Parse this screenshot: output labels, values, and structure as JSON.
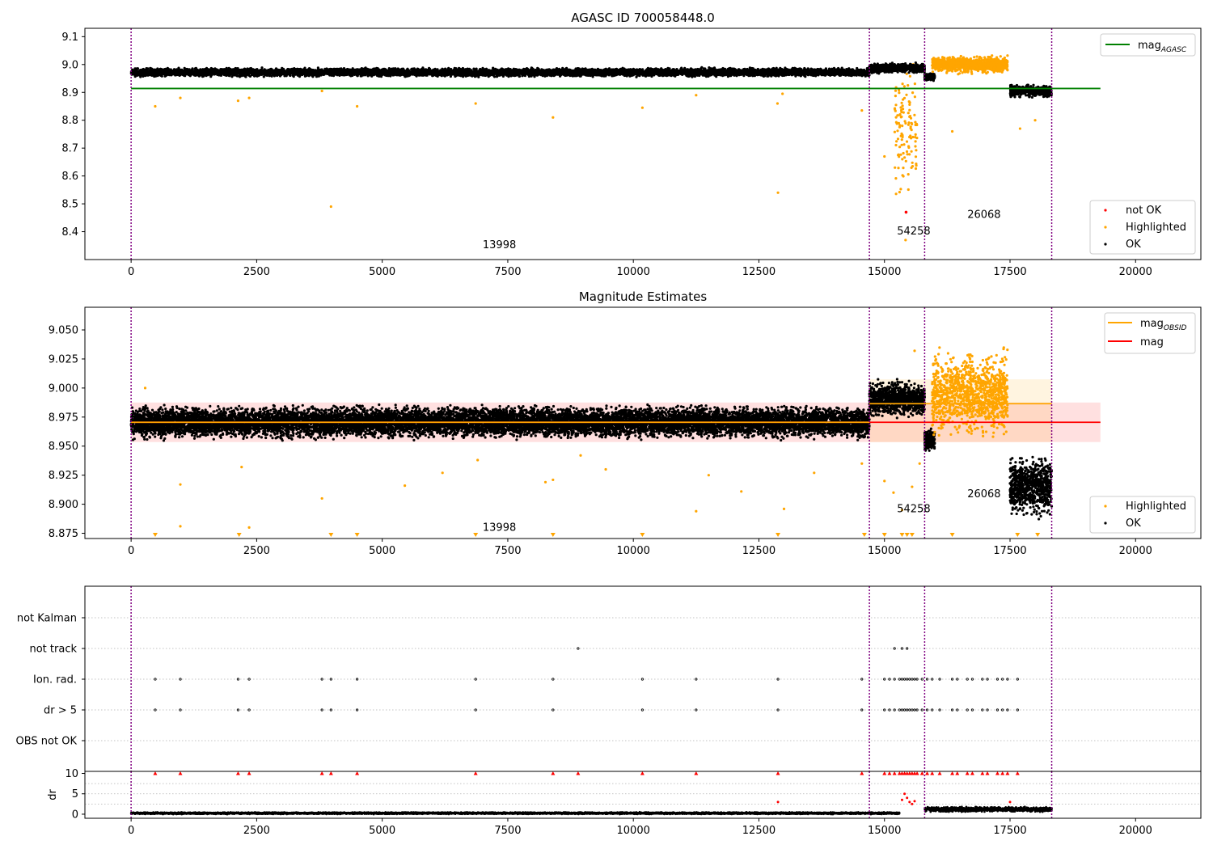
{
  "figure": {
    "vlines_x": [
      0,
      14700,
      15800,
      18330
    ],
    "colors": {
      "ok": "#000000",
      "highlighted": "#ffa500",
      "not_ok": "#ff0000",
      "mag_agasc": "#008000",
      "mag_obsid": "#ffa500",
      "mag": "#ff0000",
      "vline": "#800080",
      "grid": "#b0b0b0"
    }
  },
  "chart_data": [
    {
      "type": "scatter",
      "title": "AGASC ID 700058448.0",
      "xlim": [
        -920,
        21300
      ],
      "ylim": [
        8.3,
        9.13
      ],
      "xticks": [
        0,
        2500,
        5000,
        7500,
        10000,
        12500,
        15000,
        17500,
        20000
      ],
      "yticks": [
        8.4,
        8.5,
        8.6,
        8.7,
        8.8,
        8.9,
        9.0,
        9.1
      ],
      "ytick_labels": [
        "8.4",
        "8.5",
        "8.6",
        "8.7",
        "8.8",
        "8.9",
        "9.0",
        "9.1"
      ],
      "hlines": [
        {
          "name": "mag",
          "sub": "AGASC",
          "y": 8.914,
          "x_range": [
            0,
            19300
          ],
          "color": "#008000"
        }
      ],
      "ok_segments": [
        {
          "x": [
            0,
            14700
          ],
          "center": 8.972,
          "spread": 0.012
        },
        {
          "x": [
            14700,
            15800
          ],
          "center": 8.987,
          "spread": 0.014
        },
        {
          "x": [
            15800,
            16000
          ],
          "center": 8.955,
          "spread": 0.01
        },
        {
          "x": [
            17500,
            18330
          ],
          "center": 8.905,
          "spread": 0.018
        }
      ],
      "highlighted_segments": [
        {
          "x": [
            15950,
            17450
          ],
          "center": 9.0,
          "spread": 0.025
        },
        {
          "x": [
            15200,
            15650
          ],
          "center": 8.75,
          "spread": 0.2
        }
      ],
      "highlighted_points": [
        {
          "x": 480,
          "y": 8.85
        },
        {
          "x": 980,
          "y": 8.88
        },
        {
          "x": 2130,
          "y": 8.87
        },
        {
          "x": 2350,
          "y": 8.88
        },
        {
          "x": 3800,
          "y": 8.905
        },
        {
          "x": 3980,
          "y": 8.49
        },
        {
          "x": 4500,
          "y": 8.85
        },
        {
          "x": 6860,
          "y": 8.86
        },
        {
          "x": 8400,
          "y": 8.81
        },
        {
          "x": 10180,
          "y": 8.845
        },
        {
          "x": 11250,
          "y": 8.89
        },
        {
          "x": 12880,
          "y": 8.54
        },
        {
          "x": 12870,
          "y": 8.86
        },
        {
          "x": 12970,
          "y": 8.895
        },
        {
          "x": 14550,
          "y": 8.835
        },
        {
          "x": 15000,
          "y": 8.67
        },
        {
          "x": 15420,
          "y": 8.37
        },
        {
          "x": 16350,
          "y": 8.76
        },
        {
          "x": 17700,
          "y": 8.77
        },
        {
          "x": 18000,
          "y": 8.8
        }
      ],
      "not_ok_points": [
        {
          "x": 15430,
          "y": 8.47
        }
      ],
      "annotations": [
        {
          "text": "13998",
          "x": 7000,
          "y": 8.34
        },
        {
          "text": "54258",
          "x": 15250,
          "y": 8.39
        },
        {
          "text": "26068",
          "x": 16650,
          "y": 8.45
        }
      ],
      "legend_main": {
        "position": "top-right",
        "entries": [
          {
            "name": "mag",
            "sub": "AGASC",
            "color": "#008000"
          }
        ]
      },
      "legend_points": {
        "position": "bottom-right",
        "entries": [
          {
            "name": "not OK",
            "color": "#ff0000"
          },
          {
            "name": "Highlighted",
            "color": "#ffa500"
          },
          {
            "name": "OK",
            "color": "#000000"
          }
        ]
      }
    },
    {
      "type": "scatter",
      "title": "Magnitude Estimates",
      "xlim": [
        -920,
        21300
      ],
      "ylim": [
        8.8705,
        9.0695
      ],
      "xticks": [
        0,
        2500,
        5000,
        7500,
        10000,
        12500,
        15000,
        17500,
        20000
      ],
      "yticks": [
        8.875,
        8.9,
        8.925,
        8.95,
        8.975,
        9.0,
        9.025,
        9.05
      ],
      "ytick_labels": [
        "8.875",
        "8.900",
        "8.925",
        "8.950",
        "8.975",
        "9.000",
        "9.025",
        "9.050"
      ],
      "hlines": [
        {
          "name": "mag",
          "sub": "",
          "y": 8.9705,
          "x_range": [
            0,
            19300
          ],
          "band": [
            8.9535,
            8.9875
          ],
          "color": "#ff0000"
        },
        {
          "name": "mag",
          "sub": "OBSID",
          "y": 8.9705,
          "x_range": [
            0,
            14700
          ],
          "color": "#ffa500"
        },
        {
          "name": "mag",
          "sub": "OBSID",
          "y": 8.9865,
          "x_range": [
            14700,
            18330
          ],
          "band": [
            8.9535,
            9.0075
          ],
          "color": "#ffa500"
        }
      ],
      "ok_segments": [
        {
          "x": [
            0,
            14700
          ],
          "center": 8.9705,
          "spread": 0.011
        },
        {
          "x": [
            14700,
            15800
          ],
          "center": 8.99,
          "spread": 0.012
        },
        {
          "x": [
            15800,
            16000
          ],
          "center": 8.955,
          "spread": 0.008
        },
        {
          "x": [
            17500,
            18330
          ],
          "center": 8.915,
          "spread": 0.02
        }
      ],
      "highlighted_segments": [
        {
          "x": [
            15950,
            17450
          ],
          "center": 8.995,
          "spread": 0.03
        }
      ],
      "highlighted_points": [
        {
          "x": 280,
          "y": 9.0
        },
        {
          "x": 980,
          "y": 8.917
        },
        {
          "x": 980,
          "y": 8.881
        },
        {
          "x": 2200,
          "y": 8.932
        },
        {
          "x": 2350,
          "y": 8.88
        },
        {
          "x": 3800,
          "y": 8.905
        },
        {
          "x": 5450,
          "y": 8.916
        },
        {
          "x": 6200,
          "y": 8.927
        },
        {
          "x": 6900,
          "y": 8.938
        },
        {
          "x": 8250,
          "y": 8.919
        },
        {
          "x": 8400,
          "y": 8.921
        },
        {
          "x": 8950,
          "y": 8.942
        },
        {
          "x": 9450,
          "y": 8.93
        },
        {
          "x": 11250,
          "y": 8.894
        },
        {
          "x": 11500,
          "y": 8.925
        },
        {
          "x": 12150,
          "y": 8.911
        },
        {
          "x": 13000,
          "y": 8.896
        },
        {
          "x": 13600,
          "y": 8.927
        },
        {
          "x": 14550,
          "y": 8.935
        },
        {
          "x": 15000,
          "y": 8.92
        },
        {
          "x": 15180,
          "y": 8.91
        },
        {
          "x": 15350,
          "y": 8.895
        },
        {
          "x": 15550,
          "y": 8.915
        },
        {
          "x": 15600,
          "y": 9.032
        },
        {
          "x": 15700,
          "y": 8.935
        }
      ],
      "lower_limit_points_x": [
        480,
        2150,
        3980,
        4500,
        6860,
        8400,
        10180,
        12880,
        14600,
        15000,
        15350,
        15450,
        15550,
        16350,
        17650,
        18050
      ],
      "annotations": [
        {
          "text": "13998",
          "x": 7000,
          "y": 8.877
        },
        {
          "text": "54258",
          "x": 15250,
          "y": 8.893
        },
        {
          "text": "26068",
          "x": 16650,
          "y": 8.906
        }
      ],
      "legend_main": {
        "position": "top-right",
        "entries": [
          {
            "name": "mag",
            "sub": "OBSID",
            "color": "#ffa500"
          },
          {
            "name": "mag",
            "sub": "",
            "color": "#ff0000"
          }
        ]
      },
      "legend_points": {
        "position": "bottom-right",
        "entries": [
          {
            "name": "Highlighted",
            "color": "#ffa500"
          },
          {
            "name": "OK",
            "color": "#000000"
          }
        ]
      }
    },
    {
      "type": "scatter",
      "title": "",
      "xlim": [
        -920,
        21300
      ],
      "categories": [
        "OBS not OK",
        "dr > 5",
        "Ion. rad.",
        "not track",
        "not Kalman"
      ],
      "flag_points": {
        "dr > 5": [
          480,
          980,
          2130,
          2350,
          3800,
          3980,
          4500,
          6860,
          8400,
          10180,
          11250,
          12880,
          14550,
          15000,
          15100,
          15200,
          15300,
          15350,
          15400,
          15450,
          15500,
          15550,
          15600,
          15650,
          15750,
          15850,
          15950,
          16100,
          16350,
          16450,
          16650,
          16750,
          16950,
          17050,
          17250,
          17350,
          17450,
          17650
        ],
        "Ion. rad.": [
          480,
          980,
          2130,
          2350,
          3800,
          3980,
          4500,
          6860,
          8400,
          10180,
          11250,
          12880,
          14550,
          15000,
          15100,
          15200,
          15300,
          15350,
          15400,
          15450,
          15500,
          15550,
          15600,
          15650,
          15750,
          15850,
          15950,
          16100,
          16350,
          16450,
          16650,
          16750,
          16950,
          17050,
          17250,
          17350,
          17450,
          17650
        ],
        "not track": [
          8900,
          15200,
          15350,
          15450
        ]
      }
    },
    {
      "type": "scatter",
      "title": "",
      "ylabel": "dr",
      "xlim": [
        -920,
        21300
      ],
      "ylim": [
        -1,
        10.5
      ],
      "xticks": [
        0,
        2500,
        5000,
        7500,
        10000,
        12500,
        15000,
        17500,
        20000
      ],
      "yticks": [
        0,
        5,
        10
      ],
      "ytick_labels": [
        "0",
        "5",
        "10"
      ],
      "ok_segments": [
        {
          "x": [
            0,
            15300
          ],
          "center": 0.25,
          "spread": 0.2
        },
        {
          "x": [
            15800,
            18330
          ],
          "center": 1.2,
          "spread": 0.5
        }
      ],
      "cap_points_x": [
        480,
        980,
        2130,
        2350,
        3800,
        3980,
        4500,
        6860,
        8400,
        8900,
        10180,
        11250,
        12880,
        14550,
        15000,
        15100,
        15200,
        15300,
        15350,
        15400,
        15450,
        15500,
        15550,
        15600,
        15650,
        15750,
        15850,
        15950,
        16100,
        16350,
        16450,
        16650,
        16750,
        16950,
        17050,
        17250,
        17350,
        17450,
        17650
      ],
      "not_ok_points": [
        {
          "x": 12880,
          "y": 3.0
        },
        {
          "x": 15350,
          "y": 3.5
        },
        {
          "x": 15400,
          "y": 5.0
        },
        {
          "x": 15450,
          "y": 4.0
        },
        {
          "x": 15500,
          "y": 3.0
        },
        {
          "x": 15550,
          "y": 2.5
        },
        {
          "x": 15600,
          "y": 3.2
        },
        {
          "x": 17500,
          "y": 3.0
        }
      ]
    }
  ]
}
